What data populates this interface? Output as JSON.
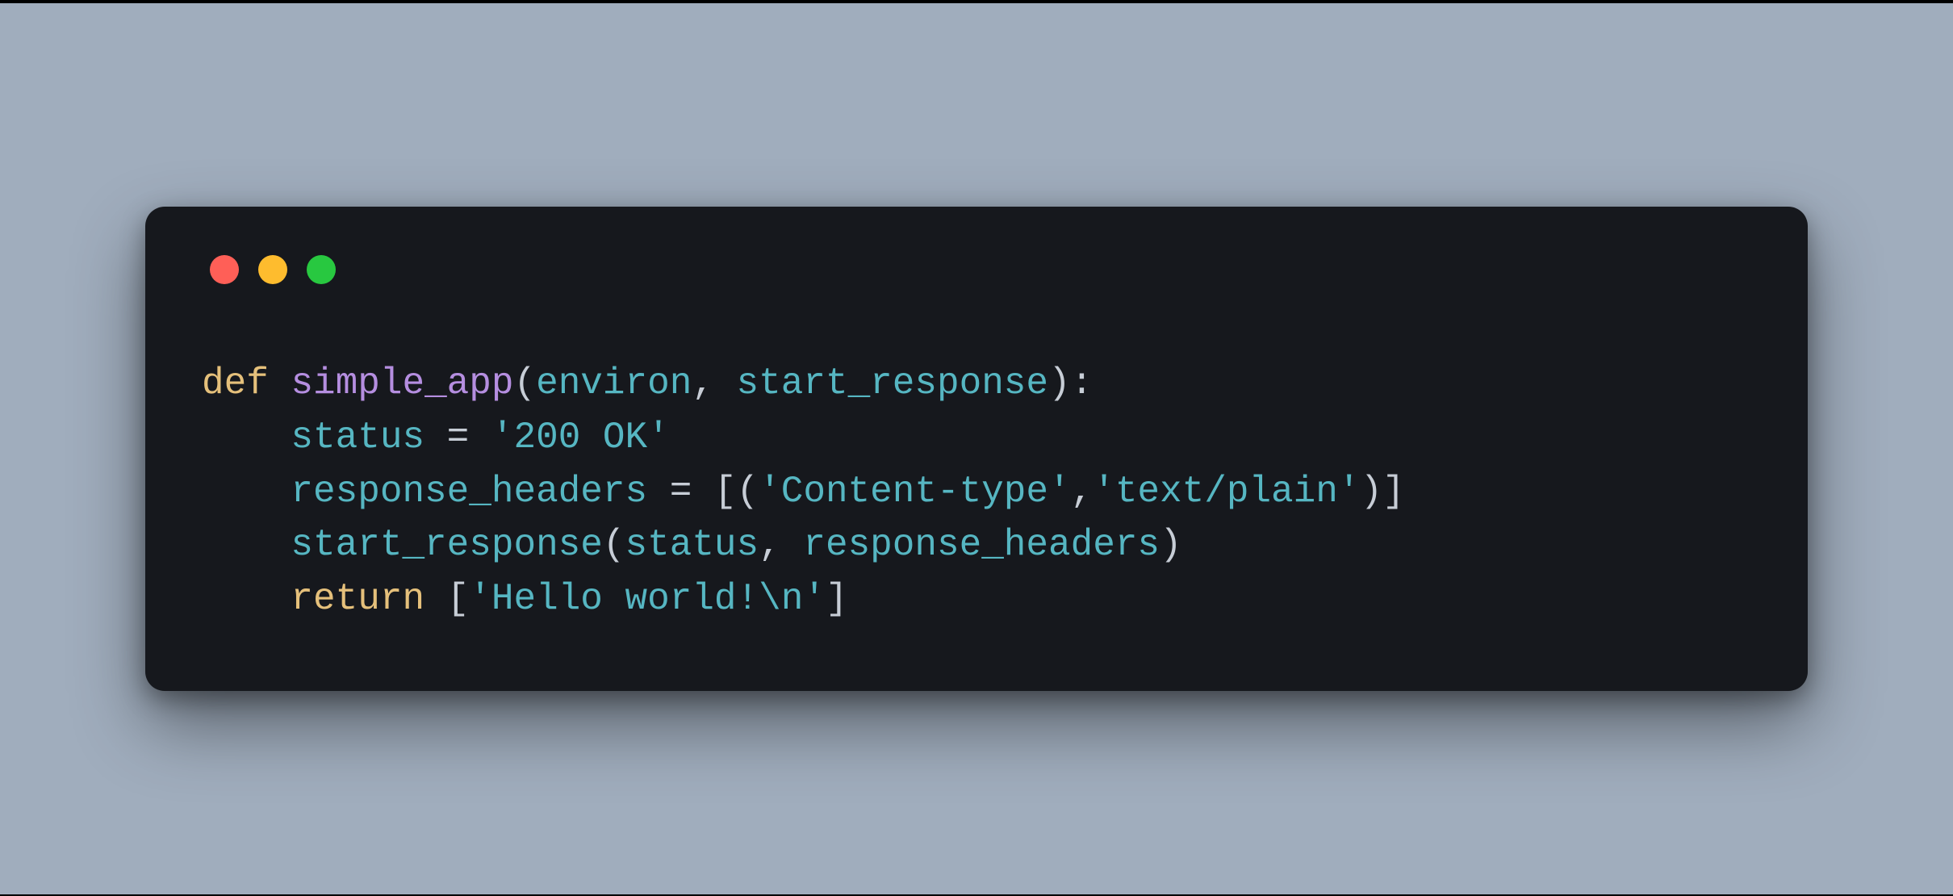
{
  "window": {
    "dots": {
      "red": "#ff5f57",
      "yellow": "#febc2e",
      "green": "#28c840"
    }
  },
  "code": {
    "kw_def": "def",
    "fn_name": "simple_app",
    "lp": "(",
    "arg1": "environ",
    "comma_sp": ", ",
    "arg2": "start_response",
    "rp_colon": "):",
    "indent": "    ",
    "var_status": "status",
    "sp_eq_sp": " = ",
    "str_status": "'200 OK'",
    "var_headers": "response_headers",
    "lbracket_lp": "[(",
    "str_ct": "'Content-type'",
    "comma": ",",
    "str_tp": "'text/plain'",
    "rp_rbracket": ")]",
    "call_sr": "start_response",
    "call_lp": "(",
    "call_arg1": "status",
    "call_arg2": "response_headers",
    "call_rp": ")",
    "kw_return": "return",
    "sp": " ",
    "ret_lbracket": "[",
    "str_hello": "'Hello world!\\n'",
    "ret_rbracket": "]"
  }
}
